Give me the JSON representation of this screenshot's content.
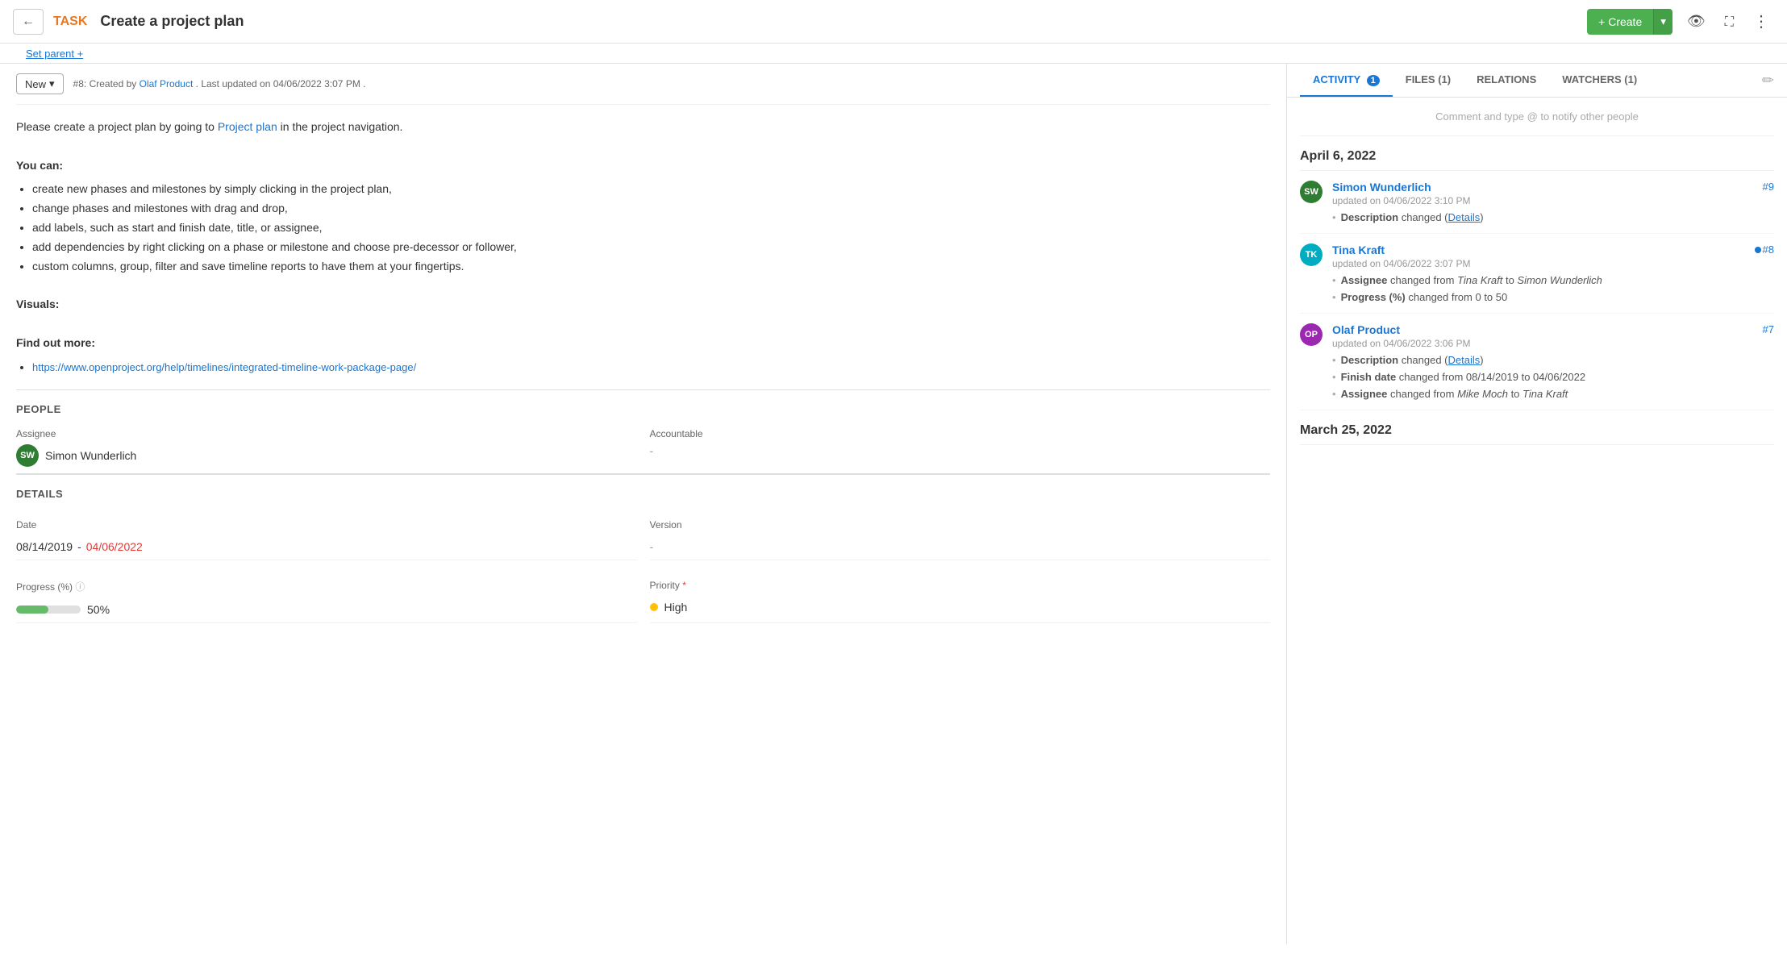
{
  "header": {
    "back_label": "←",
    "task_label": "TASK",
    "task_title": "Create a project plan",
    "create_label": "+ Create",
    "eye_icon": "👁",
    "expand_icon": "⛶",
    "more_icon": "⋮"
  },
  "set_parent": "Set parent +",
  "status": {
    "badge": "New",
    "dropdown_icon": "▾",
    "meta": "#8: Created by",
    "author": "Olaf Product",
    "last_updated": ". Last updated on 04/06/2022 3:07 PM ."
  },
  "description": {
    "intro": "Please create a project plan by going to",
    "link_text": "Project plan",
    "intro_end": "in the project navigation.",
    "you_can": "You can:",
    "bullets": [
      "create new phases and milestones by simply clicking in the project plan,",
      "change phases and milestones with drag and drop,",
      "add labels, such as start and finish date, title, or assignee,",
      "add dependencies by right clicking on a phase or milestone and choose pre-decessor or follower,",
      "custom columns, group, filter and save timeline reports to have them at your fingertips."
    ],
    "visuals_label": "Visuals:",
    "find_out_label": "Find out more:",
    "find_out_link": "https://www.openproject.org/help/timelines/integrated-timeline-work-package-page/"
  },
  "people": {
    "section_title": "PEOPLE",
    "assignee_label": "Assignee",
    "assignee_avatar": "SW",
    "assignee_name": "Simon Wunderlich",
    "accountable_label": "Accountable",
    "accountable_value": "-"
  },
  "details": {
    "section_title": "DETAILS",
    "date_label": "Date",
    "date_start": "08/14/2019",
    "date_separator": " - ",
    "date_end": "04/06/2022",
    "progress_label": "Progress (%)",
    "progress_value": 50,
    "progress_text": "50%",
    "version_label": "Version",
    "version_value": "-",
    "priority_label": "Priority",
    "priority_required": "*",
    "priority_value": "High"
  },
  "right_panel": {
    "tabs": [
      {
        "id": "activity",
        "label": "ACTIVITY",
        "badge": "1",
        "active": true
      },
      {
        "id": "files",
        "label": "FILES (1)",
        "active": false
      },
      {
        "id": "relations",
        "label": "RELATIONS",
        "active": false
      },
      {
        "id": "watchers",
        "label": "WATCHERS (1)",
        "active": false
      }
    ],
    "comment_placeholder": "Comment and type @ to notify other people",
    "date_groups": [
      {
        "date": "April 6, 2022",
        "activities": [
          {
            "id": "item-1",
            "number": "#9",
            "has_dot": false,
            "avatar": "SW",
            "avatar_class": "avatar-sw",
            "author": "Simon Wunderlich",
            "time": "updated on 04/06/2022 3:10 PM",
            "changes": [
              {
                "type": "description_changed",
                "text": "Description",
                "detail": "changed (",
                "link": "Details",
                "after": ")"
              }
            ]
          },
          {
            "id": "item-2",
            "number": "#8",
            "has_dot": true,
            "avatar": "TK",
            "avatar_class": "avatar-tk",
            "author": "Tina Kraft",
            "time": "updated on 04/06/2022 3:07 PM",
            "changes": [
              {
                "type": "assignee",
                "text": "Assignee",
                "detail": "changed from ",
                "from": "Tina Kraft",
                "to": " to ",
                "to_name": "Simon Wunderlich"
              },
              {
                "type": "progress",
                "text": "Progress (%)",
                "detail": "changed from 0 to 50"
              }
            ]
          },
          {
            "id": "item-3",
            "number": "#7",
            "has_dot": false,
            "avatar": "OP",
            "avatar_class": "avatar-op",
            "author": "Olaf Product",
            "time": "updated on 04/06/2022 3:06 PM",
            "changes": [
              {
                "type": "description_changed",
                "text": "Description",
                "detail": "changed (",
                "link": "Details",
                "after": ")"
              },
              {
                "type": "finish_date",
                "text": "Finish date",
                "detail": "changed from 08/14/2019 to 04/06/2022"
              },
              {
                "type": "assignee2",
                "text": "Assignee",
                "detail": "changed from ",
                "from": "Mike Moch",
                "to": " to ",
                "to_name": "Tina Kraft"
              }
            ]
          }
        ]
      },
      {
        "date": "March 25, 2022",
        "activities": []
      }
    ]
  }
}
